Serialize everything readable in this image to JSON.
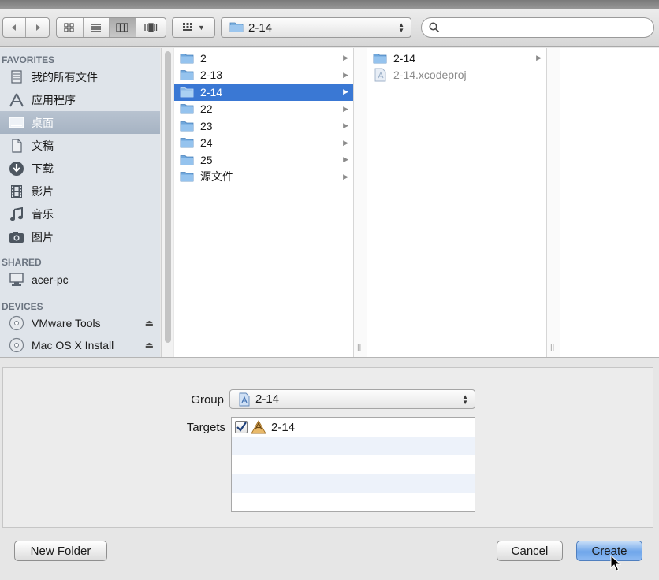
{
  "toolbar": {
    "nav_back_icon": "chevron-left-icon",
    "nav_forward_icon": "chevron-right-icon",
    "view_icons": [
      "icon-view-icon",
      "list-view-icon",
      "column-view-icon",
      "coverflow-view-icon"
    ],
    "path_popup": "2-14",
    "search_placeholder": ""
  },
  "sidebar": {
    "favorites_header": "FAVORITES",
    "favorites": [
      {
        "label": "我的所有文件",
        "icon": "all-files-icon"
      },
      {
        "label": "应用程序",
        "icon": "applications-icon"
      },
      {
        "label": "桌面",
        "icon": "desktop-icon",
        "selected": true
      },
      {
        "label": "文稿",
        "icon": "documents-icon"
      },
      {
        "label": "下载",
        "icon": "downloads-icon"
      },
      {
        "label": "影片",
        "icon": "movies-icon"
      },
      {
        "label": "音乐",
        "icon": "music-icon"
      },
      {
        "label": "图片",
        "icon": "pictures-icon"
      }
    ],
    "shared_header": "SHARED",
    "shared": [
      {
        "label": "acer-pc",
        "icon": "computer-icon"
      }
    ],
    "devices_header": "DEVICES",
    "devices": [
      {
        "label": "VMware Tools",
        "icon": "disc-icon"
      },
      {
        "label": "Mac OS X Install",
        "icon": "disc-icon"
      }
    ]
  },
  "columns": {
    "col1": [
      {
        "label": "2"
      },
      {
        "label": "2-13"
      },
      {
        "label": "2-14",
        "selected": true
      },
      {
        "label": "22"
      },
      {
        "label": "23"
      },
      {
        "label": "24"
      },
      {
        "label": "25"
      },
      {
        "label": "源文件"
      }
    ],
    "col2": [
      {
        "label": "2-14",
        "type": "folder"
      },
      {
        "label": "2-14.xcodeproj",
        "type": "file"
      }
    ]
  },
  "options": {
    "group_label": "Group",
    "group_value": "2-14",
    "targets_label": "Targets",
    "target_value": "2-14",
    "target_checked": true
  },
  "buttons": {
    "new_folder": "New Folder",
    "cancel": "Cancel",
    "create": "Create"
  }
}
